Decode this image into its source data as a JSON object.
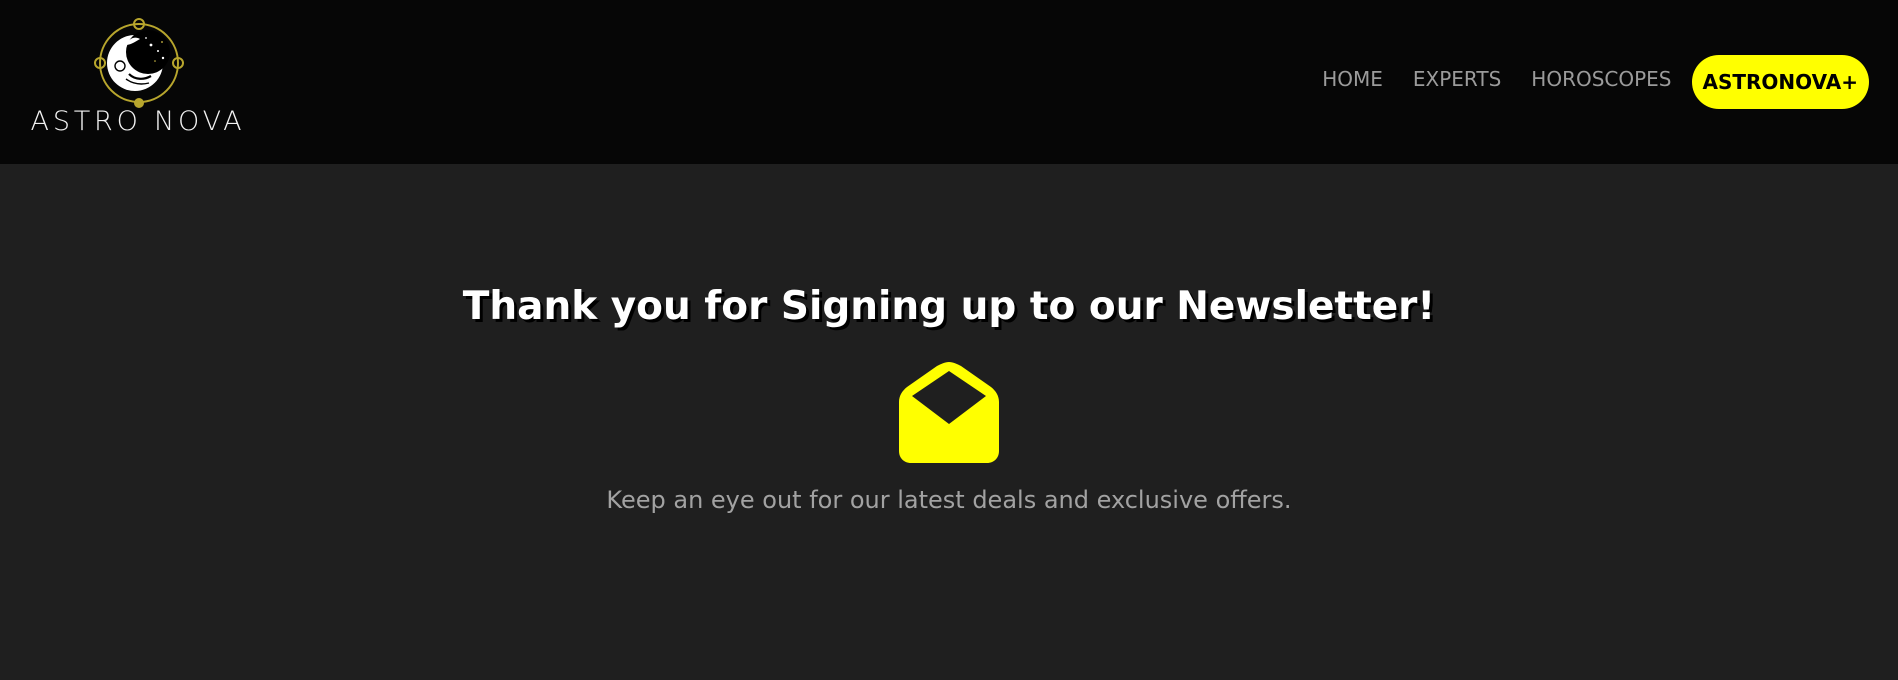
{
  "brand": {
    "name": "ASTRO NOVA",
    "accent_color": "#FFFF00",
    "logo_icon": "moon-orbit-logo-icon"
  },
  "nav": {
    "items": [
      {
        "label": "HOME"
      },
      {
        "label": "EXPERTS"
      },
      {
        "label": "HOROSCOPES"
      }
    ],
    "cta_label": "ASTRONOVA+"
  },
  "content": {
    "headline": "Thank you for Signing up to our Newsletter!",
    "icon": "open-envelope-icon",
    "subtext": "Keep an eye out for our latest deals and exclusive offers."
  }
}
